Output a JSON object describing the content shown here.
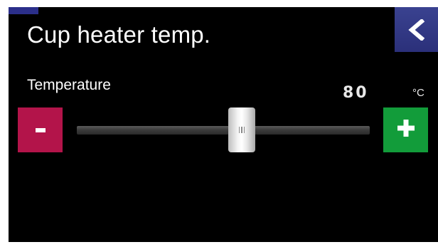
{
  "screen": {
    "title": "Cup heater temp."
  },
  "back_button": {
    "icon": "chevron-left-icon"
  },
  "temperature": {
    "label": "Temperature",
    "value": "80",
    "unit": "°C",
    "slider_fraction": 0.57
  },
  "controls": {
    "minus_icon": "minus-icon",
    "plus_icon": "plus-icon"
  },
  "colors": {
    "background": "#000000",
    "back_button": "#2b307a",
    "minus_button": "#b3144a",
    "plus_button": "#129c3a",
    "text": "#ffffff"
  }
}
